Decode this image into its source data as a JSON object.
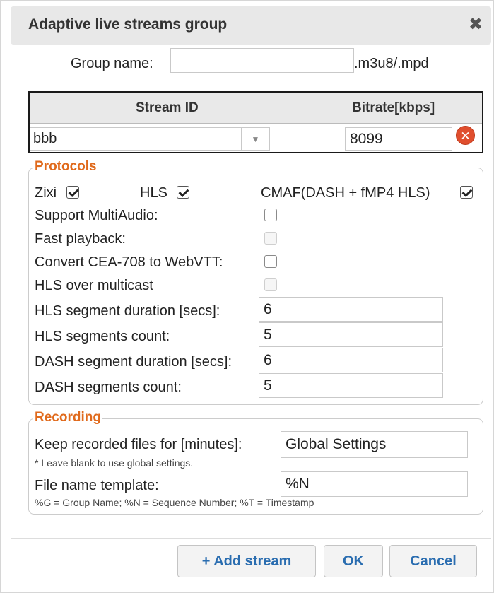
{
  "dialog": {
    "title": "Adaptive live streams group",
    "close_glyph": "✖"
  },
  "group_name": {
    "label": "Group name:",
    "value": "",
    "suffix": ".m3u8/.mpd"
  },
  "streams": {
    "headers": {
      "stream_id": "Stream ID",
      "bitrate": "Bitrate[kbps]"
    },
    "rows": [
      {
        "stream_id": "bbb",
        "bitrate": "8099"
      }
    ]
  },
  "protocols": {
    "legend": "Protocols",
    "zixi": {
      "label": "Zixi",
      "checked": true
    },
    "hls": {
      "label": "HLS",
      "checked": true
    },
    "cmaf": {
      "label": "CMAF(DASH + fMP4 HLS)",
      "checked": true
    },
    "support_multiaudio": {
      "label": "Support MultiAudio:",
      "checked": false
    },
    "fast_playback": {
      "label": "Fast playback:",
      "checked": false,
      "disabled": true
    },
    "convert_cea": {
      "label": "Convert CEA-708 to WebVTT:",
      "checked": false
    },
    "hls_multicast": {
      "label": "HLS over multicast",
      "checked": false,
      "disabled": true
    },
    "hls_segment_duration": {
      "label": "HLS segment duration [secs]:",
      "value": "6"
    },
    "hls_segments_count": {
      "label": "HLS segments count:",
      "value": "5"
    },
    "dash_segment_duration": {
      "label": "DASH segment duration [secs]:",
      "value": "6"
    },
    "dash_segments_count": {
      "label": "DASH segments count:",
      "value": "5"
    }
  },
  "recording": {
    "legend": "Recording",
    "keep_files": {
      "label": "Keep recorded files for [minutes]:",
      "value": "Global Settings"
    },
    "keep_note": "* Leave blank to use global settings.",
    "file_template": {
      "label": "File name template:",
      "value": "%N"
    },
    "template_note": "%G = Group Name; %N = Sequence Number; %T = Timestamp"
  },
  "buttons": {
    "add_stream": "+ Add stream",
    "ok": "OK",
    "cancel": "Cancel"
  },
  "colors": {
    "accent": "#e06a1c",
    "button_text": "#2a6db0",
    "remove": "#e04e2e"
  }
}
